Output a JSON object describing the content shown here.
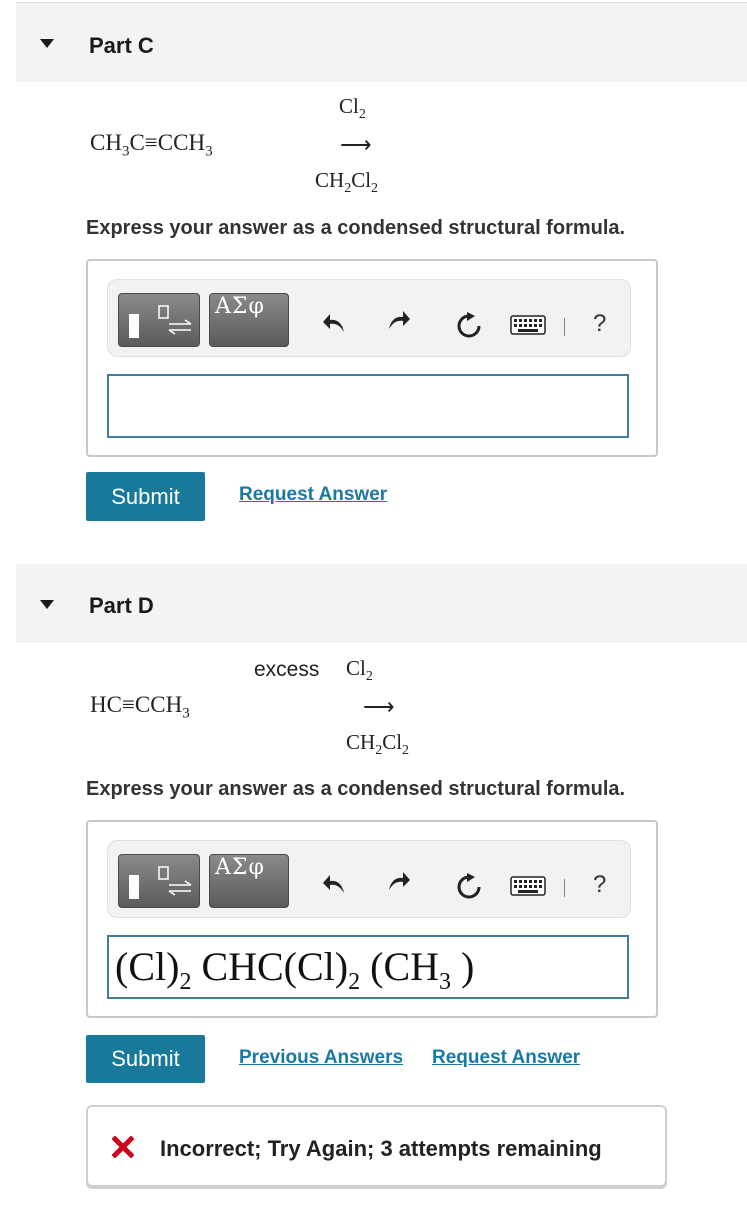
{
  "colors": {
    "accent": "#18799a",
    "link": "#1a79a3",
    "error": "#d0021b",
    "input_border": "#3f7f99"
  },
  "part_c": {
    "title": "Part C",
    "reactant": "CH3C≡CCH3",
    "reagent_top": "Cl2",
    "solvent": "CH2Cl2",
    "instruction": "Express your answer as a condensed structural formula.",
    "answer_value": "",
    "submit_label": "Submit",
    "request_label": "Request Answer"
  },
  "part_d": {
    "title": "Part D",
    "reactant": "HC≡CCH3",
    "reagent_prefix": "excess",
    "reagent_top": "Cl2",
    "solvent": "CH2Cl2",
    "instruction": "Express your answer as a condensed structural formula.",
    "answer_value": "(Cl)2 CHC(Cl)2 (CH3 )",
    "submit_label": "Submit",
    "previous_label": "Previous Answers",
    "request_label": "Request Answer",
    "feedback": "Incorrect; Try Again; 3 attempts remaining"
  },
  "toolbar": {
    "template_icon": "template-icon",
    "symbols_label": "ΑΣφ",
    "undo_icon": "undo-icon",
    "redo_icon": "redo-icon",
    "reset_icon": "reset-icon",
    "keyboard_icon": "keyboard-icon",
    "help_label": "?"
  }
}
